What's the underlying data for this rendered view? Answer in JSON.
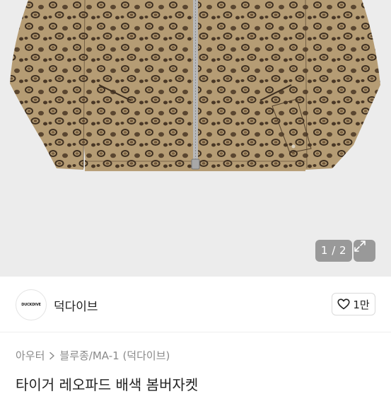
{
  "product_image": {
    "alt": "",
    "counter": "1 / 2",
    "colors": {
      "base": "#b59c74",
      "spot": "#5a4630",
      "ring": "#3e2f20",
      "zipper": "#b8b8b8"
    }
  },
  "seller": {
    "avatar_text": "DUCKDIVE",
    "name": "덕다이브",
    "like_label": "1만"
  },
  "breadcrumb": {
    "items": [
      "아우터",
      "블루종/MA-1 (덕다이브)"
    ],
    "separator_icon": "chevron-right-icon"
  },
  "product": {
    "title": "타이거 레오파드 배색 봄버자켓"
  }
}
